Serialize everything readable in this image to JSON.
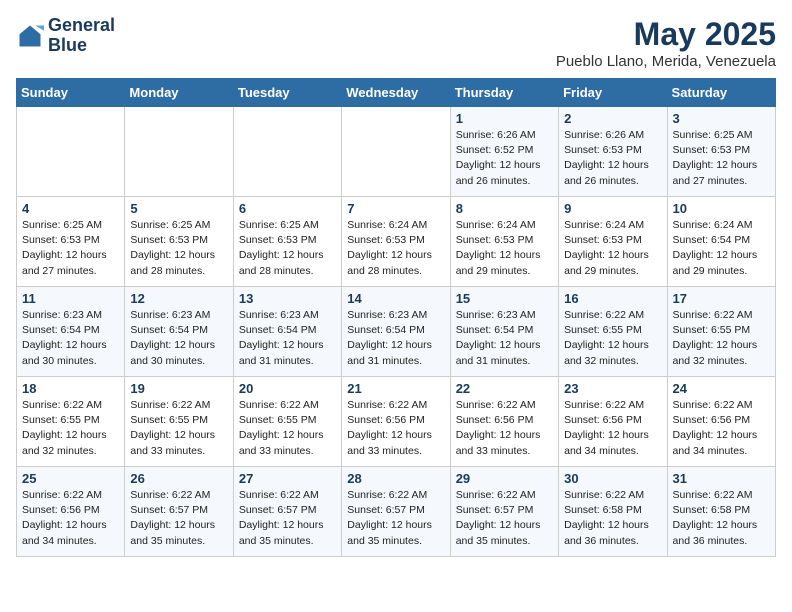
{
  "logo": {
    "line1": "General",
    "line2": "Blue"
  },
  "title": "May 2025",
  "location": "Pueblo Llano, Merida, Venezuela",
  "days_of_week": [
    "Sunday",
    "Monday",
    "Tuesday",
    "Wednesday",
    "Thursday",
    "Friday",
    "Saturday"
  ],
  "weeks": [
    [
      {
        "day": "",
        "info": ""
      },
      {
        "day": "",
        "info": ""
      },
      {
        "day": "",
        "info": ""
      },
      {
        "day": "",
        "info": ""
      },
      {
        "day": "1",
        "info": "Sunrise: 6:26 AM\nSunset: 6:52 PM\nDaylight: 12 hours\nand 26 minutes."
      },
      {
        "day": "2",
        "info": "Sunrise: 6:26 AM\nSunset: 6:53 PM\nDaylight: 12 hours\nand 26 minutes."
      },
      {
        "day": "3",
        "info": "Sunrise: 6:25 AM\nSunset: 6:53 PM\nDaylight: 12 hours\nand 27 minutes."
      }
    ],
    [
      {
        "day": "4",
        "info": "Sunrise: 6:25 AM\nSunset: 6:53 PM\nDaylight: 12 hours\nand 27 minutes."
      },
      {
        "day": "5",
        "info": "Sunrise: 6:25 AM\nSunset: 6:53 PM\nDaylight: 12 hours\nand 28 minutes."
      },
      {
        "day": "6",
        "info": "Sunrise: 6:25 AM\nSunset: 6:53 PM\nDaylight: 12 hours\nand 28 minutes."
      },
      {
        "day": "7",
        "info": "Sunrise: 6:24 AM\nSunset: 6:53 PM\nDaylight: 12 hours\nand 28 minutes."
      },
      {
        "day": "8",
        "info": "Sunrise: 6:24 AM\nSunset: 6:53 PM\nDaylight: 12 hours\nand 29 minutes."
      },
      {
        "day": "9",
        "info": "Sunrise: 6:24 AM\nSunset: 6:53 PM\nDaylight: 12 hours\nand 29 minutes."
      },
      {
        "day": "10",
        "info": "Sunrise: 6:24 AM\nSunset: 6:54 PM\nDaylight: 12 hours\nand 29 minutes."
      }
    ],
    [
      {
        "day": "11",
        "info": "Sunrise: 6:23 AM\nSunset: 6:54 PM\nDaylight: 12 hours\nand 30 minutes."
      },
      {
        "day": "12",
        "info": "Sunrise: 6:23 AM\nSunset: 6:54 PM\nDaylight: 12 hours\nand 30 minutes."
      },
      {
        "day": "13",
        "info": "Sunrise: 6:23 AM\nSunset: 6:54 PM\nDaylight: 12 hours\nand 31 minutes."
      },
      {
        "day": "14",
        "info": "Sunrise: 6:23 AM\nSunset: 6:54 PM\nDaylight: 12 hours\nand 31 minutes."
      },
      {
        "day": "15",
        "info": "Sunrise: 6:23 AM\nSunset: 6:54 PM\nDaylight: 12 hours\nand 31 minutes."
      },
      {
        "day": "16",
        "info": "Sunrise: 6:22 AM\nSunset: 6:55 PM\nDaylight: 12 hours\nand 32 minutes."
      },
      {
        "day": "17",
        "info": "Sunrise: 6:22 AM\nSunset: 6:55 PM\nDaylight: 12 hours\nand 32 minutes."
      }
    ],
    [
      {
        "day": "18",
        "info": "Sunrise: 6:22 AM\nSunset: 6:55 PM\nDaylight: 12 hours\nand 32 minutes."
      },
      {
        "day": "19",
        "info": "Sunrise: 6:22 AM\nSunset: 6:55 PM\nDaylight: 12 hours\nand 33 minutes."
      },
      {
        "day": "20",
        "info": "Sunrise: 6:22 AM\nSunset: 6:55 PM\nDaylight: 12 hours\nand 33 minutes."
      },
      {
        "day": "21",
        "info": "Sunrise: 6:22 AM\nSunset: 6:56 PM\nDaylight: 12 hours\nand 33 minutes."
      },
      {
        "day": "22",
        "info": "Sunrise: 6:22 AM\nSunset: 6:56 PM\nDaylight: 12 hours\nand 33 minutes."
      },
      {
        "day": "23",
        "info": "Sunrise: 6:22 AM\nSunset: 6:56 PM\nDaylight: 12 hours\nand 34 minutes."
      },
      {
        "day": "24",
        "info": "Sunrise: 6:22 AM\nSunset: 6:56 PM\nDaylight: 12 hours\nand 34 minutes."
      }
    ],
    [
      {
        "day": "25",
        "info": "Sunrise: 6:22 AM\nSunset: 6:56 PM\nDaylight: 12 hours\nand 34 minutes."
      },
      {
        "day": "26",
        "info": "Sunrise: 6:22 AM\nSunset: 6:57 PM\nDaylight: 12 hours\nand 35 minutes."
      },
      {
        "day": "27",
        "info": "Sunrise: 6:22 AM\nSunset: 6:57 PM\nDaylight: 12 hours\nand 35 minutes."
      },
      {
        "day": "28",
        "info": "Sunrise: 6:22 AM\nSunset: 6:57 PM\nDaylight: 12 hours\nand 35 minutes."
      },
      {
        "day": "29",
        "info": "Sunrise: 6:22 AM\nSunset: 6:57 PM\nDaylight: 12 hours\nand 35 minutes."
      },
      {
        "day": "30",
        "info": "Sunrise: 6:22 AM\nSunset: 6:58 PM\nDaylight: 12 hours\nand 36 minutes."
      },
      {
        "day": "31",
        "info": "Sunrise: 6:22 AM\nSunset: 6:58 PM\nDaylight: 12 hours\nand 36 minutes."
      }
    ]
  ]
}
